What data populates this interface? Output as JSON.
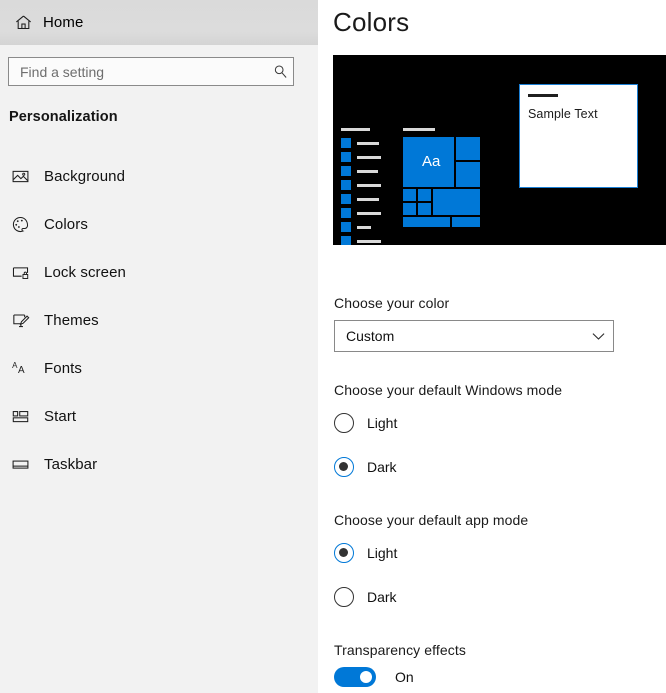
{
  "sidebar": {
    "home_label": "Home",
    "home_icon": "home-icon",
    "search": {
      "placeholder": "Find a setting",
      "value": "",
      "icon": "search-icon"
    },
    "section_title": "Personalization",
    "items": [
      {
        "label": "Background",
        "icon": "image-icon"
      },
      {
        "label": "Colors",
        "icon": "palette-icon"
      },
      {
        "label": "Lock screen",
        "icon": "lock-screen-icon"
      },
      {
        "label": "Themes",
        "icon": "brush-icon"
      },
      {
        "label": "Fonts",
        "icon": "fonts-aa-icon"
      },
      {
        "label": "Start",
        "icon": "start-tiles-icon"
      },
      {
        "label": "Taskbar",
        "icon": "taskbar-icon"
      }
    ]
  },
  "content": {
    "page_title": "Colors",
    "preview": {
      "background_color": "#000000",
      "accent_color": "#0078d7",
      "tile_text": "Aa",
      "window_text": "Sample Text",
      "window_border_color": "#1b7fd4",
      "applist_rows": 8
    },
    "choose_color": {
      "label": "Choose your color",
      "selected": "Custom",
      "chevron_icon": "chevron-down-icon"
    },
    "windows_mode": {
      "label": "Choose your default Windows mode",
      "options": [
        {
          "label": "Light",
          "selected": false
        },
        {
          "label": "Dark",
          "selected": true
        }
      ]
    },
    "app_mode": {
      "label": "Choose your default app mode",
      "options": [
        {
          "label": "Light",
          "selected": true
        },
        {
          "label": "Dark",
          "selected": false
        }
      ]
    },
    "transparency": {
      "label": "Transparency effects",
      "state": "On",
      "on": true
    }
  }
}
